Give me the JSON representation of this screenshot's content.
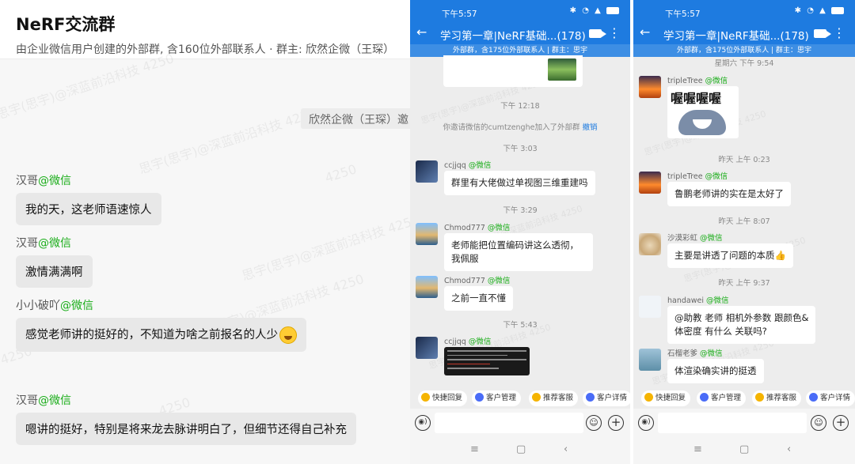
{
  "left": {
    "title": "NeRF交流群",
    "subtitle": "由企业微信用户创建的外部群, 含160位外部联系人 · 群主: 欣然企微（王琛）",
    "sys_text": "欣然企微（王琛）邀",
    "watermark": "思宇(思宇)@深蓝前沿科技 4250",
    "watermark_short": "4250",
    "messages": [
      {
        "sender": "汉哥",
        "tag": "@微信",
        "text": "我的天，这老师语速惊人"
      },
      {
        "sender": "汉哥",
        "tag": "@微信",
        "text": "激情满满啊"
      },
      {
        "sender": "小小破吖",
        "tag": "@微信",
        "text": "感觉老师讲的挺好的，不知道为啥之前报名的人少"
      },
      {
        "sender": "汉哥",
        "tag": "@微信",
        "text": "嗯讲的挺好，特别是将来龙去脉讲明白了，但细节还得自己补充"
      }
    ]
  },
  "phone1": {
    "status_time": "下午5:57",
    "status_icons": "✱ ◔ ▲ ",
    "battery": "84",
    "chat_title": "学习第一章|NeRF基础...(178)",
    "info": "外部群，含175位外部联系人 | 群主：思宇",
    "watermark": "思宇(思宇)@深蓝前沿科技 4250",
    "items": {
      "t1": "下午 12:18",
      "sys": "你邀请微信的cumtzenghe加入了外部群",
      "revoke": "撤销",
      "t2": "下午 3:03",
      "m1_name": "ccjjqq",
      "m1_text": "群里有大佬做过单视图三维重建吗",
      "t3": "下午 3:29",
      "m2_name": "Chmod777",
      "m2_text": "老师能把位置编码讲这么透彻，我佩服",
      "m3_name": "Chmod777",
      "m3_text": "之前一直不懂",
      "t4": "下午 5:43",
      "m4_name": "ccjjqq"
    },
    "tag": "@微信"
  },
  "phone2": {
    "status_time": "下午5:57",
    "status_icons": "✱ ◔ ▲ ",
    "battery": "84",
    "chat_title": "学习第一章|NeRF基础...(178)",
    "info": "外部群，含175位外部联系人 | 群主：思宇",
    "watermark": "思宇(思宇)@深蓝前沿科技 4250",
    "items": {
      "t0": "星期六 下午 9:54",
      "m1_name": "tripleTree",
      "sticker_text": "喔喔喔喔",
      "t1": "昨天 上午 0:23",
      "m2_name": "tripleTree",
      "m2_text": "鲁鹏老师讲的实在是太好了",
      "t2": "昨天 上午 8:07",
      "m3_name": "沙漠彩虹",
      "m3_text": "主要是讲透了问题的本质👍",
      "t3": "昨天 上午 9:37",
      "m4_name": "handawei",
      "m4_text_1": "@助教 老师 相机外参数 跟颜色&",
      "m4_text_2": "体密度 有什么 关联吗?",
      "m5_name": "石榴老爹",
      "m5_text": "体渲染确实讲的挺透"
    },
    "tag": "@微信"
  },
  "quickbar": [
    "快捷回复",
    "客户管理",
    "推荐客服",
    "客户详情"
  ],
  "navbar": {
    "menu": "≡",
    "home": "▢",
    "back": "‹"
  },
  "icons": {
    "back": "←",
    "more": "⋮",
    "voice": "◉)",
    "smile": "☺",
    "plus": "+"
  }
}
